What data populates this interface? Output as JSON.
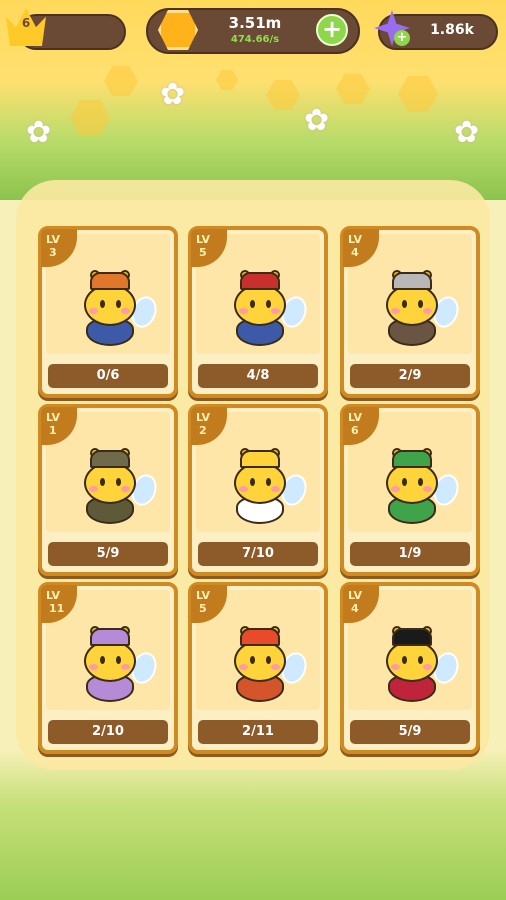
{
  "header": {
    "player_level": "6",
    "honey_amount": "3.51m",
    "honey_rate": "474.66/s",
    "gem_amount": "1.86k",
    "plus_symbol": "+"
  },
  "colors": {
    "honey": "#ffb21a",
    "gem": "#9a6cf2",
    "plus_green": "#8ed64a",
    "card_border": "#d08a24",
    "progress_bg": "#8d5a2a"
  },
  "cards": [
    {
      "lv_label": "LV",
      "level": "3",
      "progress": "0/6",
      "suit": "#3d5aa8",
      "hat": "#e0772a",
      "icon": "farmer-bee-icon"
    },
    {
      "lv_label": "LV",
      "level": "5",
      "progress": "4/8",
      "suit": "#3d5aa8",
      "hat": "#c9302c",
      "icon": "mailman-bee-icon"
    },
    {
      "lv_label": "LV",
      "level": "4",
      "progress": "2/9",
      "suit": "#6a5442",
      "hat": "#b8b8b8",
      "icon": "bucket-bee-icon"
    },
    {
      "lv_label": "LV",
      "level": "1",
      "progress": "5/9",
      "suit": "#5d5a3a",
      "hat": "#6f6a4a",
      "icon": "soldier-bee-icon"
    },
    {
      "lv_label": "LV",
      "level": "2",
      "progress": "7/10",
      "suit": "#ffffff",
      "hat": "#ffd43a",
      "icon": "doctor-bee-icon"
    },
    {
      "lv_label": "LV",
      "level": "6",
      "progress": "1/9",
      "suit": "#3fa34a",
      "hat": "#3fa34a",
      "icon": "knight-bee-icon"
    },
    {
      "lv_label": "LV",
      "level": "11",
      "progress": "2/10",
      "suit": "#b58bd8",
      "hat": "#b58bd8",
      "icon": "bunny-bee-icon"
    },
    {
      "lv_label": "LV",
      "level": "5",
      "progress": "2/11",
      "suit": "#d4552a",
      "hat": "#e84a2a",
      "icon": "chief-bee-icon"
    },
    {
      "lv_label": "LV",
      "level": "4",
      "progress": "5/9",
      "suit": "#c0243a",
      "hat": "#1a1a1a",
      "icon": "guard-bee-icon"
    }
  ]
}
